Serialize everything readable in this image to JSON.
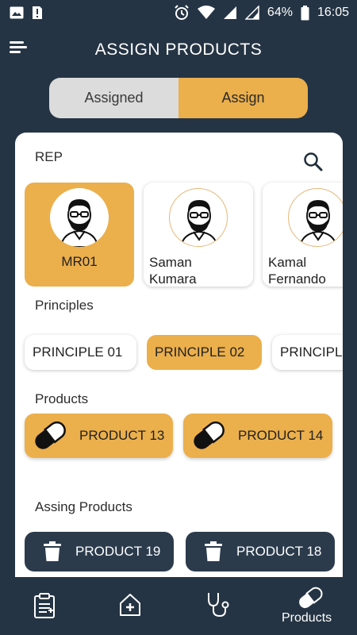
{
  "status_bar": {
    "battery": "64%",
    "time": "16:05",
    "icons": [
      "image-icon",
      "sim-alert-icon",
      "alarm-icon",
      "wifi-icon",
      "signal-icon",
      "signal-icon",
      "battery-icon"
    ]
  },
  "header": {
    "title": "ASSIGN PRODUCTS",
    "menu_icon": "menu-icon"
  },
  "toggle": {
    "assigned_label": "Assigned",
    "assign_label": "Assign",
    "active": "Assign"
  },
  "rep_section": {
    "label": "REP",
    "search_icon": "search-icon",
    "reps": [
      {
        "name": "MR01",
        "selected": true
      },
      {
        "name": "Saman\nKumara",
        "selected": false
      },
      {
        "name": "Kamal\nFernando",
        "selected": false
      }
    ]
  },
  "principles_section": {
    "label": "Principles",
    "items": [
      {
        "label": "PRINCIPLE 01",
        "selected": false
      },
      {
        "label": "PRINCIPLE 02",
        "selected": true
      },
      {
        "label": "PRINCIPLE",
        "selected": false
      }
    ]
  },
  "products_section": {
    "label": "Products",
    "items": [
      {
        "label": "PRODUCT 13",
        "icon": "capsule-icon"
      },
      {
        "label": "PRODUCT 14",
        "icon": "capsule-icon"
      }
    ]
  },
  "assigning_section": {
    "label": "Assing Products",
    "items": [
      {
        "label": "PRODUCT 19",
        "icon": "trash-icon"
      },
      {
        "label": "PRODUCT 18",
        "icon": "trash-icon"
      }
    ]
  },
  "bottom_nav": {
    "items": [
      {
        "icon": "clipboard-icon",
        "label": ""
      },
      {
        "icon": "medical-house-icon",
        "label": ""
      },
      {
        "icon": "stethoscope-icon",
        "label": ""
      },
      {
        "icon": "capsule-icon",
        "label": "Products"
      }
    ]
  },
  "colors": {
    "background": "#253444",
    "accent": "#ebaf4c",
    "card": "#ffffff",
    "dark_button": "#2b3b4c"
  }
}
